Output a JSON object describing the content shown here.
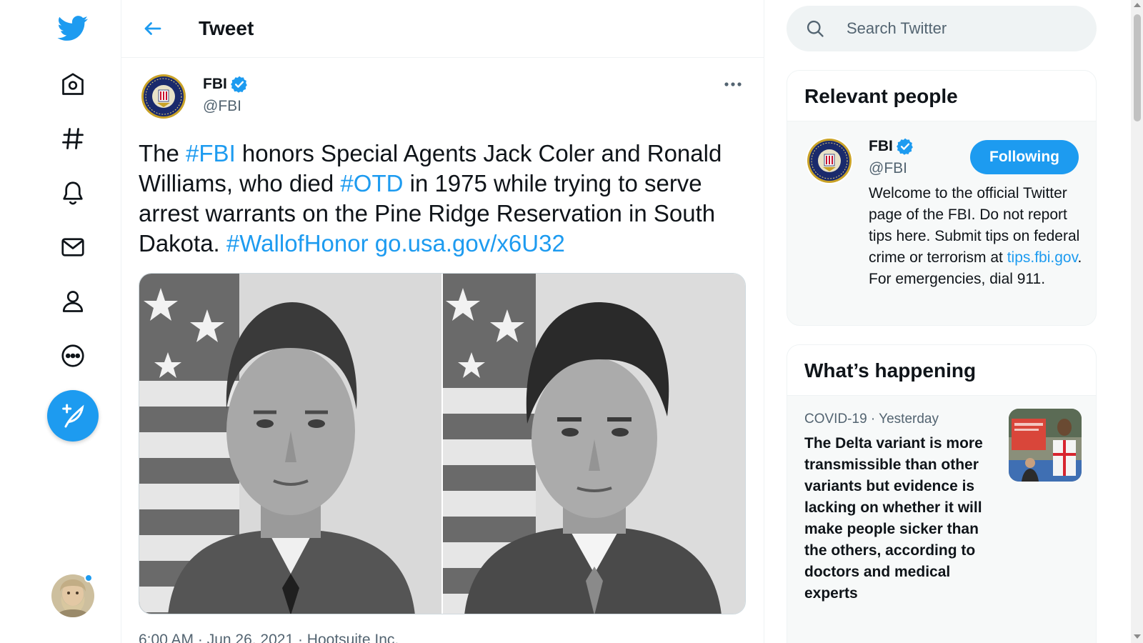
{
  "header": {
    "title": "Tweet"
  },
  "tweet": {
    "author_name": "FBI",
    "author_handle": "@FBI",
    "text_parts": [
      {
        "t": "The ",
        "link": false
      },
      {
        "t": "#FBI",
        "link": true
      },
      {
        "t": " honors Special Agents Jack Coler and Ronald Williams, who died ",
        "link": false
      },
      {
        "t": "#OTD",
        "link": true
      },
      {
        "t": " in 1975 while trying to serve arrest warrants on the Pine Ridge Reservation in South Dakota. ",
        "link": false
      },
      {
        "t": "#WallofHonor",
        "link": true
      },
      {
        "t": " ",
        "link": false
      },
      {
        "t": "go.usa.gov/x6U32",
        "link": true
      }
    ],
    "meta": "6:00 AM · Jun 26, 2021 · Hootsuite Inc."
  },
  "search": {
    "placeholder": "Search Twitter"
  },
  "relevant_people": {
    "title": "Relevant people",
    "name": "FBI",
    "handle": "@FBI",
    "follow_label": "Following",
    "bio_before": "Welcome to the official Twitter page of the FBI. Do not report tips here. Submit tips on federal crime or terrorism at ",
    "bio_link": "tips.fbi.gov",
    "bio_after": ". For emergencies, dial 911."
  },
  "whats_happening": {
    "title": "What’s happening",
    "trend_meta": "COVID-19 · Yesterday",
    "trend_text": "The Delta variant is more transmissible than other variants but evidence is lacking on whether it will make people sicker than the others, according to doctors and medical experts"
  },
  "colors": {
    "accent": "#1d9bf0",
    "text": "#0f1419",
    "muted": "#536471"
  }
}
